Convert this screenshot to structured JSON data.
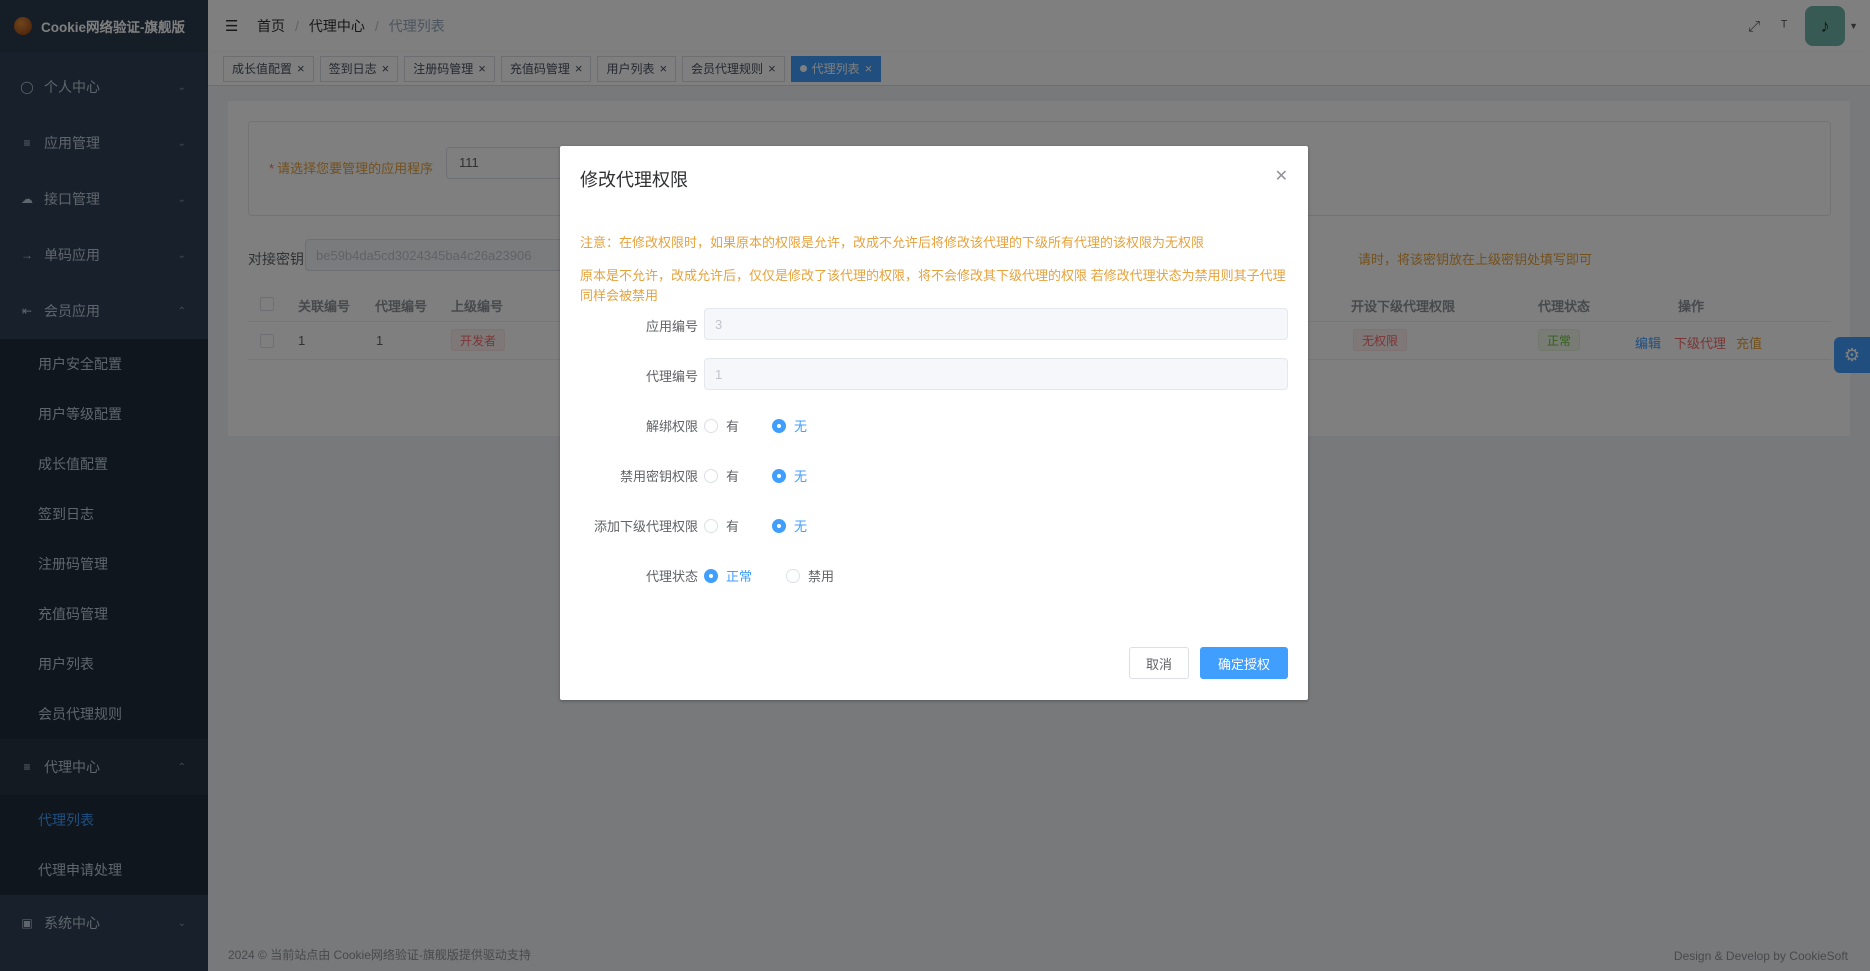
{
  "app": {
    "title": "Cookie网络验证-旗舰版"
  },
  "sidebar": {
    "items": [
      {
        "label": "个人中心",
        "icon": "user-icon",
        "expanded": false
      },
      {
        "label": "应用管理",
        "icon": "tree-icon",
        "expanded": false
      },
      {
        "label": "接口管理",
        "icon": "cloud-icon",
        "expanded": false
      },
      {
        "label": "单码应用",
        "icon": "login-icon",
        "expanded": false
      },
      {
        "label": "会员应用",
        "icon": "collapse-icon",
        "expanded": true
      }
    ],
    "member_sub": [
      "用户安全配置",
      "用户等级配置",
      "成长值配置",
      "签到日志",
      "注册码管理",
      "充值码管理",
      "用户列表",
      "会员代理规则"
    ],
    "agent_center": {
      "label": "代理中心",
      "icon": "tree-icon",
      "expanded": true
    },
    "agent_sub": [
      {
        "label": "代理列表",
        "active": true
      },
      {
        "label": "代理申请处理",
        "active": false
      }
    ],
    "system": {
      "label": "系统中心",
      "icon": "monitor-icon",
      "expanded": false
    }
  },
  "header": {
    "breadcrumb": [
      "首页",
      "代理中心",
      "代理列表"
    ],
    "separator": "/"
  },
  "tags": [
    {
      "label": "成长值配置",
      "active": false
    },
    {
      "label": "签到日志",
      "active": false
    },
    {
      "label": "注册码管理",
      "active": false
    },
    {
      "label": "充值码管理",
      "active": false
    },
    {
      "label": "用户列表",
      "active": false
    },
    {
      "label": "会员代理规则",
      "active": false
    },
    {
      "label": "代理列表",
      "active": true
    }
  ],
  "page": {
    "app_select_label": "请选择您要管理的应用程序",
    "app_select_value": "111",
    "key_label": "对接密钥",
    "key_value": "be59b4da5cd3024345ba4c26a23906",
    "key_tip": "请时，将该密钥放在上级密钥处填写即可",
    "table": {
      "headers_left": [
        "关联编号",
        "代理编号",
        "上级编号"
      ],
      "headers_right": [
        "开设下级代理权限",
        "代理状态",
        "操作"
      ],
      "row": {
        "link_id": "1",
        "agent_id": "1",
        "parent_badge": "开发者",
        "sub_perm_badge": "无权限",
        "status_badge": "正常",
        "ops": [
          "编辑",
          "下级代理",
          "充值"
        ]
      }
    },
    "footer_left": "2024 © 当前站点由 Cookie网络验证-旗舰版提供驱动支持",
    "footer_right": "Design & Develop by CookieSoft"
  },
  "dialog": {
    "title": "修改代理权限",
    "notice1": "注意：在修改权限时，如果原本的权限是允许，改成不允许后将修改该代理的下级所有代理的该权限为无权限",
    "notice2": "原本是不允许，改成允许后，仅仅是修改了该代理的权限，将不会修改其下级代理的权限 若修改代理状态为禁用则其子代理同样会被禁用",
    "fields": {
      "app_id": {
        "label": "应用编号",
        "value": "3"
      },
      "agent_id": {
        "label": "代理编号",
        "value": "1"
      },
      "unbind": {
        "label": "解绑权限",
        "options": [
          "有",
          "无"
        ],
        "selected": "无"
      },
      "ban_key": {
        "label": "禁用密钥权限",
        "options": [
          "有",
          "无"
        ],
        "selected": "无"
      },
      "add_sub": {
        "label": "添加下级代理权限",
        "options": [
          "有",
          "无"
        ],
        "selected": "无"
      },
      "status": {
        "label": "代理状态",
        "options": [
          "正常",
          "禁用"
        ],
        "selected": "正常"
      }
    },
    "cancel_label": "取消",
    "confirm_label": "确定授权"
  },
  "colors": {
    "sidebar_bg": "#304156",
    "submenu_bg": "#1f2d3d",
    "primary": "#409eff",
    "warning": "#e6a23c",
    "danger": "#f56c6c",
    "success": "#67c23a"
  }
}
